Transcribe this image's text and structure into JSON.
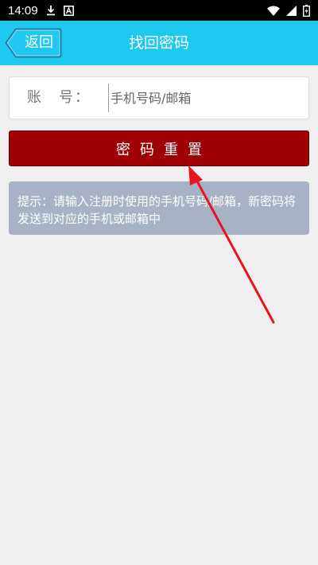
{
  "status_bar": {
    "time": "14:09",
    "icons": [
      "download-icon",
      "app-a-icon",
      "wifi-icon",
      "signal-icon",
      "battery-icon"
    ]
  },
  "header": {
    "back_label": "返回",
    "title": "找回密码"
  },
  "form": {
    "account_label_1": "账",
    "account_label_2": "号：",
    "account_placeholder": "手机号码/邮箱",
    "account_value": "",
    "submit_label": "密码重置"
  },
  "hint": {
    "text": "提示：请输入注册时使用的手机号码/邮箱，新密码将发送到对应的手机或邮箱中"
  },
  "colors": {
    "header_bg": "#1ec8ee",
    "submit_bg": "#9e0006",
    "hint_bg": "#a7b3c4",
    "annotation_arrow": "#e8141c"
  }
}
